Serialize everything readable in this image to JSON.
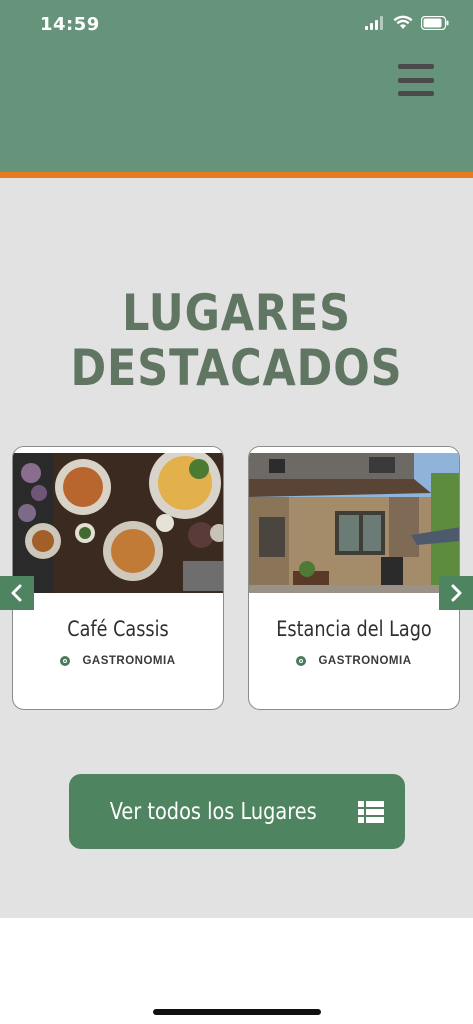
{
  "status_bar": {
    "time": "14:59"
  },
  "header": {
    "menu_icon": "hamburger-menu-icon"
  },
  "colors": {
    "header_bg": "#66947a",
    "accent_border": "#e87a1f",
    "title_color": "#607562",
    "button_bg": "#4f8461",
    "page_bg": "#e2e2e2"
  },
  "section": {
    "title_line1": "LUGARES",
    "title_line2": "DESTACADOS"
  },
  "cards": [
    {
      "title": "Café Cassis",
      "category": "GASTRONOMIA",
      "image": "food-table-photo"
    },
    {
      "title": "Estancia del Lago",
      "category": "GASTRONOMIA",
      "image": "building-facade-photo"
    }
  ],
  "carousel": {
    "prev_icon": "chevron-left-icon",
    "next_icon": "chevron-right-icon"
  },
  "cta": {
    "label": "Ver todos los Lugares",
    "icon": "list-icon"
  }
}
